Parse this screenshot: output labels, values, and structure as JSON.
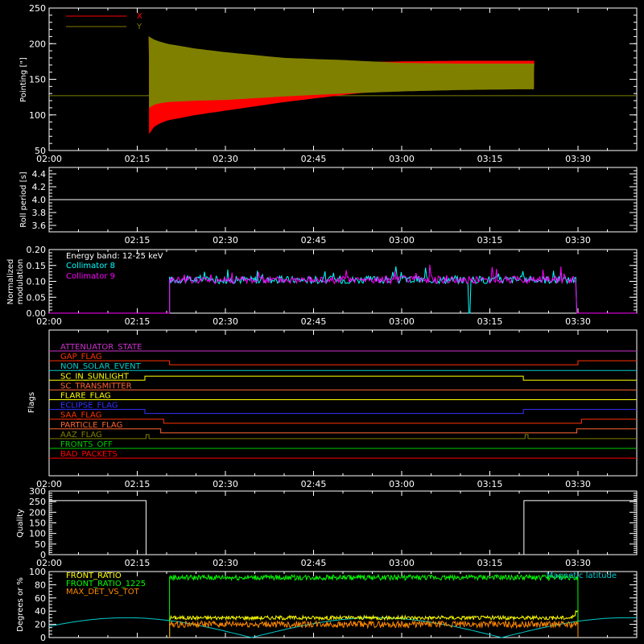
{
  "chart_data": [
    {
      "type": "line",
      "id": "pointing",
      "ylabel": "Pointing [\"]",
      "ylim": [
        50,
        250
      ],
      "yticks": [
        50,
        100,
        150,
        200,
        250
      ],
      "xlim_minutes": [
        0,
        100
      ],
      "xticks": [
        "02:00",
        "02:15",
        "02:30",
        "02:45",
        "03:00",
        "03:15",
        "03:30"
      ],
      "reference_line": 127,
      "series": [
        {
          "name": "X",
          "color": "#ff0000",
          "x_minutes": [
            17,
            18,
            20,
            25,
            30,
            40,
            50,
            60,
            70,
            80,
            82.5
          ],
          "upper": [
            210,
            190,
            182,
            178,
            176,
            175,
            174,
            175,
            176,
            176,
            176
          ],
          "lower": [
            73,
            85,
            92,
            100,
            106,
            118,
            128,
            137,
            140,
            141,
            141
          ]
        },
        {
          "name": "Y",
          "color": "#808000",
          "x_minutes": [
            17,
            18,
            20,
            25,
            30,
            40,
            50,
            60,
            70,
            80,
            82.5
          ],
          "upper": [
            210,
            205,
            200,
            193,
            188,
            180,
            177,
            173,
            172,
            172,
            172
          ],
          "lower": [
            110,
            115,
            118,
            120,
            121,
            126,
            130,
            133,
            135,
            136,
            136
          ]
        }
      ]
    },
    {
      "type": "line",
      "id": "roll",
      "ylabel": "Roll period [s]",
      "ylim": [
        3.5,
        4.5
      ],
      "yticks": [
        "3.6",
        "3.8",
        "4.0",
        "4.2",
        "4.4"
      ],
      "xticks": [
        "02:15",
        "02:30",
        "02:45",
        "03:00",
        "03:15",
        "03:30"
      ],
      "series": [
        {
          "name": "",
          "color": "#ffffff",
          "x_minutes": [
            0,
            100
          ],
          "values": [
            4.0,
            4.0
          ]
        }
      ]
    },
    {
      "type": "line",
      "id": "modulation",
      "ylabel": "Normalized modulation",
      "ylim": [
        0,
        0.2
      ],
      "yticks": [
        "0.00",
        "0.05",
        "0.10",
        "0.15",
        "0.20"
      ],
      "xticks": [
        "02:00",
        "02:15",
        "02:30",
        "02:45",
        "03:00",
        "03:15",
        "03:30"
      ],
      "annotation": "Energy band: 12-25 keV",
      "active_range_minutes": [
        20.5,
        89.8
      ],
      "dropout_minute": 71.5,
      "series": [
        {
          "name": "Collimator 8",
          "color": "#00ffff",
          "base": 0.105,
          "amp": 0.012
        },
        {
          "name": "Collimator 9",
          "color": "#ff00ff",
          "base": 0.105,
          "amp": 0.012
        }
      ]
    },
    {
      "type": "line",
      "id": "flags",
      "ylabel": "Flags",
      "xticks": [
        "02:00",
        "02:15",
        "02:30",
        "02:45",
        "03:00",
        "03:15",
        "03:30"
      ],
      "flags": [
        {
          "name": "ATTENUATOR_STATE",
          "color": "#cc33cc",
          "transitions": []
        },
        {
          "name": "GAP_FLAG",
          "color": "#ff3300",
          "transitions": [
            [
              20.5,
              -1
            ],
            [
              90.0,
              1
            ]
          ]
        },
        {
          "name": "NON_SOLAR_EVENT",
          "color": "#00cccc",
          "transitions": []
        },
        {
          "name": "SC_IN_SUNLIGHT",
          "color": "#ffff00",
          "transitions": [
            [
              16.3,
              1
            ],
            [
              80.7,
              -1
            ]
          ]
        },
        {
          "name": "SC_TRANSMITTER",
          "color": "#ff6633",
          "transitions": []
        },
        {
          "name": "FLARE_FLAG",
          "color": "#ffff00",
          "transitions": []
        },
        {
          "name": "ECLIPSE_FLAG",
          "color": "#3333ff",
          "transitions": [
            [
              16.3,
              -1
            ],
            [
              80.7,
              1
            ]
          ]
        },
        {
          "name": "SAA_FLAG",
          "color": "#ff3300",
          "transitions": [
            [
              19.5,
              -1
            ],
            [
              90.6,
              1
            ]
          ]
        },
        {
          "name": "PARTICLE_FLAG",
          "color": "#ff6633",
          "transitions": [
            [
              19.0,
              -1
            ],
            [
              89.8,
              1
            ]
          ]
        },
        {
          "name": "AAZ_FLAG",
          "color": "#808000",
          "pulses": [
            [
              16.5,
              17.0
            ],
            [
              81.0,
              81.5
            ]
          ]
        },
        {
          "name": "FRONTS_OFF",
          "color": "#00cc00",
          "transitions": []
        },
        {
          "name": "BAD_PACKETS",
          "color": "#ff0000",
          "transitions": []
        }
      ]
    },
    {
      "type": "line",
      "id": "quality",
      "ylabel": "Quality",
      "ylim": [
        0,
        300
      ],
      "yticks": [
        "0",
        "50",
        "100",
        "150",
        "200",
        "250",
        "300"
      ],
      "xticks": [
        "02:00",
        "02:15",
        "02:30",
        "02:45",
        "03:00",
        "03:15",
        "03:30"
      ],
      "series": [
        {
          "name": "",
          "color": "#ffffff",
          "x_minutes": [
            0,
            16.5,
            16.5,
            80.8,
            80.8,
            100
          ],
          "values": [
            255,
            255,
            0,
            0,
            255,
            255
          ]
        }
      ]
    },
    {
      "type": "line",
      "id": "front_ratio",
      "ylabel": "Degrees or %",
      "ylim": [
        0,
        100
      ],
      "yticks": [
        "0",
        "20",
        "40",
        "60",
        "80",
        "100"
      ],
      "active_range_minutes": [
        20.5,
        90.0
      ],
      "series": [
        {
          "name": "FRONT_RATIO",
          "color": "#ffff00",
          "base": 30,
          "amp": 3
        },
        {
          "name": "FRONT_RATIO_1225",
          "color": "#00ff00",
          "base": 91,
          "amp": 4
        },
        {
          "name": "MAX_DET_VS_TOT",
          "color": "#ff8800",
          "base": 20,
          "amp": 5
        },
        {
          "name": "Magnetic latitude",
          "color": "#00cccc"
        }
      ]
    }
  ]
}
